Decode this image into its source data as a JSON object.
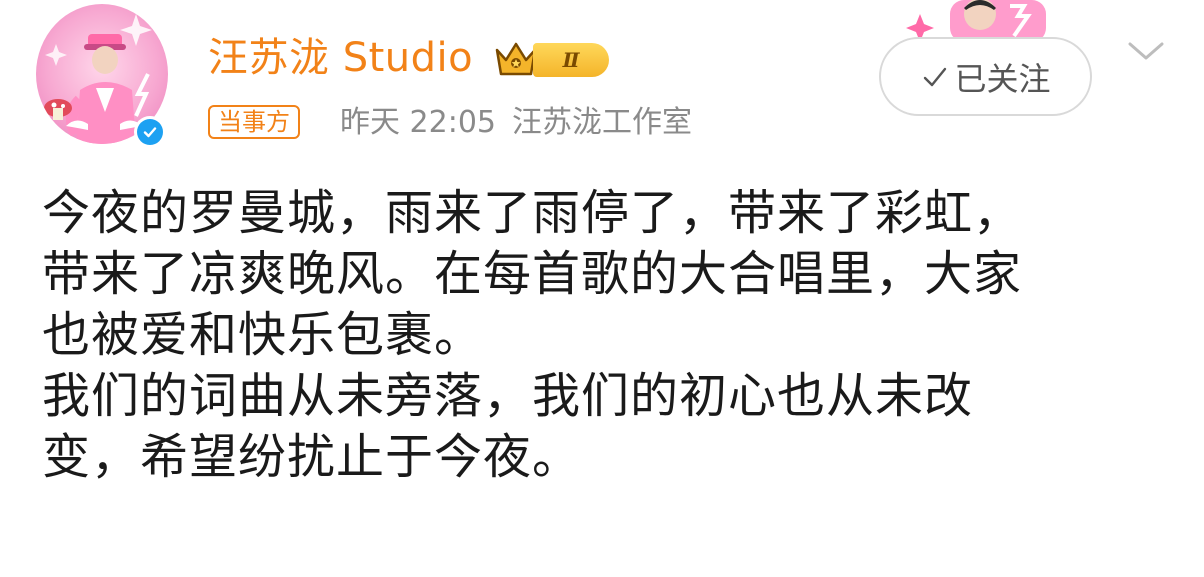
{
  "account": {
    "name": "汪苏泷 Studio",
    "level": "Ⅱ",
    "tag": "当事方",
    "time": "昨天 22:05",
    "source": "汪苏泷工作室"
  },
  "actions": {
    "follow_label": "已关注"
  },
  "post": {
    "lines": [
      "今夜的罗曼城，雨来了雨停了，带来了彩虹，",
      "带来了凉爽晚风。在每首歌的大合唱里，大家",
      "也被爱和快乐包裹。",
      "我们的词曲从未旁落，我们的初心也从未改",
      "变，希望纷扰止于今夜。"
    ]
  },
  "icons": {
    "verified": "verified-check-icon",
    "crown": "crown-icon",
    "follow_check": "check-icon",
    "menu": "chevron-down-icon"
  },
  "colors": {
    "name": "#f28218",
    "meta": "#8a8a8a",
    "verified": "#1da1f2",
    "badge": "#f4b42a"
  }
}
